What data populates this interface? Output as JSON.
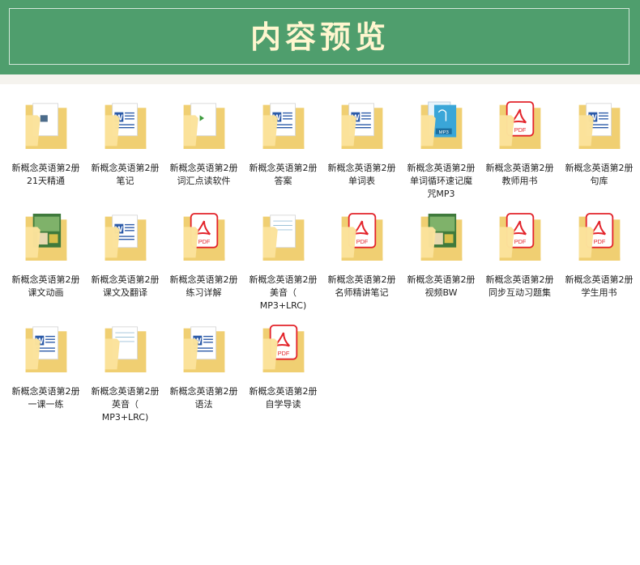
{
  "header": {
    "title": "内容预览"
  },
  "files": [
    {
      "line1": "新概念英语第2册",
      "line2": "21天精通",
      "line3": "",
      "icon": "folder-with-image-icon"
    },
    {
      "line1": "新概念英语第2册",
      "line2": "笔记",
      "line3": "",
      "icon": "folder-with-word-icon"
    },
    {
      "line1": "新概念英语第2册",
      "line2": "词汇点读软件",
      "line3": "",
      "icon": "folder-with-software-icon"
    },
    {
      "line1": "新概念英语第2册",
      "line2": "答案",
      "line3": "",
      "icon": "folder-with-word-icon"
    },
    {
      "line1": "新概念英语第2册",
      "line2": "单词表",
      "line3": "",
      "icon": "folder-with-word-icon"
    },
    {
      "line1": "新概念英语第2册",
      "line2": "单词循环速记魔",
      "line3": "咒MP3",
      "icon": "folder-with-audio-icon"
    },
    {
      "line1": "新概念英语第2册",
      "line2": "教师用书",
      "line3": "",
      "icon": "folder-with-pdf-icon"
    },
    {
      "line1": "新概念英语第2册",
      "line2": "句库",
      "line3": "",
      "icon": "folder-with-word-icon"
    },
    {
      "line1": "新概念英语第2册",
      "line2": "课文动画",
      "line3": "",
      "icon": "folder-with-video-icon"
    },
    {
      "line1": "新概念英语第2册",
      "line2": "课文及翻译",
      "line3": "",
      "icon": "folder-with-word-icon"
    },
    {
      "line1": "新概念英语第2册",
      "line2": "练习详解",
      "line3": "",
      "icon": "folder-with-pdf-icon"
    },
    {
      "line1": "新概念英语第2册",
      "line2": "美音（",
      "line3": "MP3+LRC)",
      "icon": "folder-with-files-icon"
    },
    {
      "line1": "新概念英语第2册",
      "line2": "名师精讲笔记",
      "line3": "",
      "icon": "folder-with-pdf-icon"
    },
    {
      "line1": "新概念英语第2册",
      "line2": "视频BW",
      "line3": "",
      "icon": "folder-with-video-icon"
    },
    {
      "line1": "新概念英语第2册",
      "line2": "同步互动习题集",
      "line3": "",
      "icon": "folder-with-pdf-icon"
    },
    {
      "line1": "新概念英语第2册",
      "line2": "学生用书",
      "line3": "",
      "icon": "folder-with-pdf-icon"
    },
    {
      "line1": "新概念英语第2册",
      "line2": "一课一练",
      "line3": "",
      "icon": "folder-with-word-icon"
    },
    {
      "line1": "新概念英语第2册",
      "line2": "英音（",
      "line3": "MP3+LRC)",
      "icon": "folder-with-files-icon"
    },
    {
      "line1": "新概念英语第2册",
      "line2": "语法",
      "line3": "",
      "icon": "folder-with-word-icon"
    },
    {
      "line1": "新概念英语第2册",
      "line2": "自学导读",
      "line3": "",
      "icon": "folder-with-pdf-icon"
    }
  ],
  "colors": {
    "banner": "#4f9e6d",
    "title": "#fff6cf",
    "folder_back": "#f0cf72",
    "folder_front": "#fbe29b",
    "word_blue": "#2b5aa8",
    "pdf_red": "#e3242b"
  },
  "pdf_badge": "PDF",
  "word_badge": "W",
  "mp3_badge": "MP3"
}
